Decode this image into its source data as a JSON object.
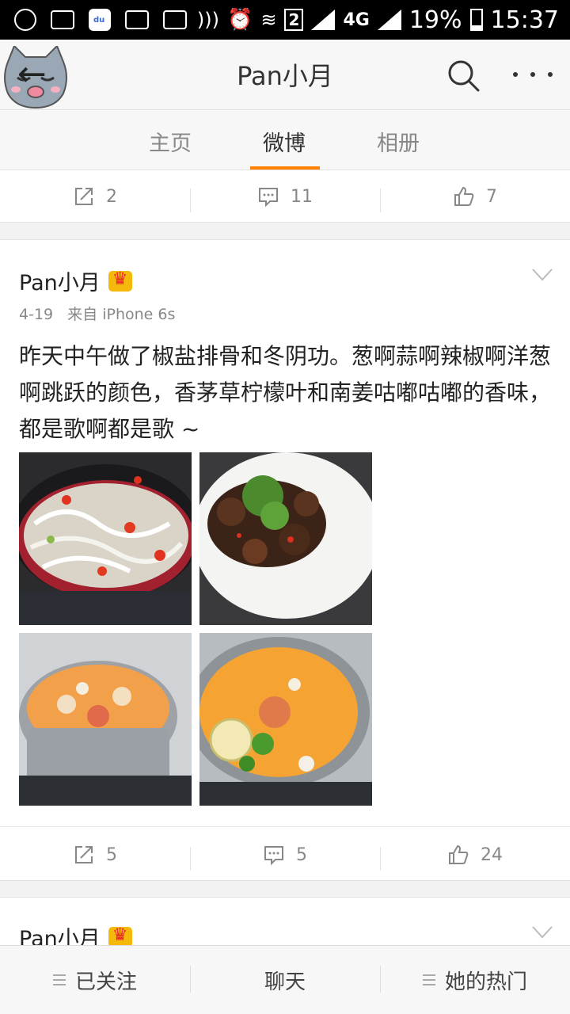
{
  "status_bar": {
    "network_label": "4G",
    "sim_label": "2",
    "battery": "19%",
    "time": "15:37"
  },
  "header": {
    "title": "Pan小月"
  },
  "tabs": [
    {
      "label": "主页",
      "active": false
    },
    {
      "label": "微博",
      "active": true
    },
    {
      "label": "相册",
      "active": false
    }
  ],
  "prev_post_actions": {
    "repost": "2",
    "comment": "11",
    "like": "7"
  },
  "post": {
    "author": "Pan小月",
    "date": "4-19",
    "source": "来自 iPhone 6s",
    "text": "昨天中午做了椒盐排骨和冬阴功。葱啊蒜啊辣椒啊洋葱啊跳跃的颜色，香茅草柠檬叶和南姜咕嘟咕嘟的香味，都是歌啊都是歌 ~",
    "photo_icons": [
      "frying-pan-onions-photo",
      "salt-pepper-ribs-photo",
      "tom-yum-pot-photo",
      "tom-yum-soup-photo"
    ],
    "actions": {
      "repost": "5",
      "comment": "5",
      "like": "24"
    }
  },
  "next_post": {
    "author": "Pan小月"
  },
  "bottom_bar": {
    "follow": "已关注",
    "chat": "聊天",
    "hot": "她的热门"
  },
  "colors": {
    "accent": "#ff8200",
    "background": "#f2f2f2",
    "card": "#ffffff",
    "muted_text": "#888888"
  }
}
